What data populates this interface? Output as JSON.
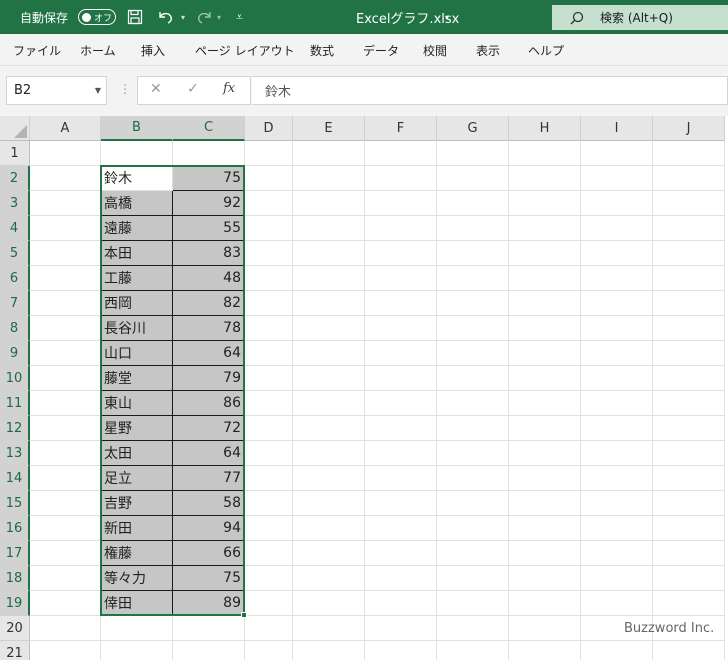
{
  "titlebar": {
    "autosave_label": "自動保存",
    "autosave_state": "オフ",
    "doc_title": "Excelグラフ.xlsx",
    "search_placeholder": "検索 (Alt+Q)"
  },
  "ribbon": {
    "tabs": [
      "ファイル",
      "ホーム",
      "挿入",
      "ページ レイアウト",
      "数式",
      "データ",
      "校閲",
      "表示",
      "ヘルプ"
    ]
  },
  "formula_bar": {
    "name_box": "B2",
    "fx_label": "fx",
    "content": "鈴木"
  },
  "sheet": {
    "columns": [
      "A",
      "B",
      "C",
      "D",
      "E",
      "F",
      "G",
      "H",
      "I",
      "J"
    ],
    "rows": [
      "1",
      "2",
      "3",
      "4",
      "5",
      "6",
      "7",
      "8",
      "9",
      "10",
      "11",
      "12",
      "13",
      "14",
      "15",
      "16",
      "17",
      "18",
      "19",
      "20",
      "21"
    ],
    "selected_columns": [
      "B",
      "C"
    ],
    "selected_range": "B2:C19",
    "data": [
      {
        "name": "鈴木",
        "value": "75"
      },
      {
        "name": "高橋",
        "value": "92"
      },
      {
        "name": "遠藤",
        "value": "55"
      },
      {
        "name": "本田",
        "value": "83"
      },
      {
        "name": "工藤",
        "value": "48"
      },
      {
        "name": "西岡",
        "value": "82"
      },
      {
        "name": "長谷川",
        "value": "78"
      },
      {
        "name": "山口",
        "value": "64"
      },
      {
        "name": "藤堂",
        "value": "79"
      },
      {
        "name": "東山",
        "value": "86"
      },
      {
        "name": "星野",
        "value": "72"
      },
      {
        "name": "太田",
        "value": "64"
      },
      {
        "name": "足立",
        "value": "77"
      },
      {
        "name": "吉野",
        "value": "58"
      },
      {
        "name": "新田",
        "value": "94"
      },
      {
        "name": "権藤",
        "value": "66"
      },
      {
        "name": "等々力",
        "value": "75"
      },
      {
        "name": "倖田",
        "value": "89"
      }
    ]
  },
  "watermark": "Buzzword Inc.",
  "colors": {
    "excel_green": "#217346",
    "selection_shade": "#c6c6c6",
    "header_bg": "#e6e6e6"
  }
}
